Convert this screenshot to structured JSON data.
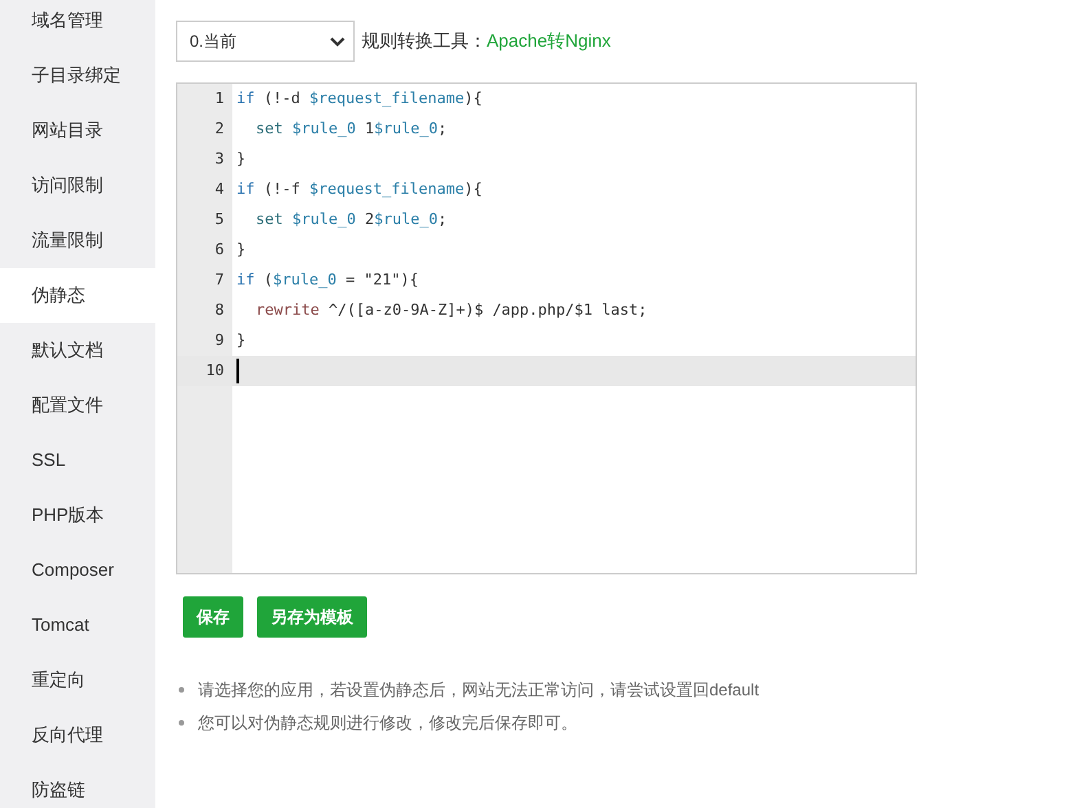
{
  "sidebar": {
    "items": [
      {
        "label": "域名管理",
        "selected": false
      },
      {
        "label": "子目录绑定",
        "selected": false
      },
      {
        "label": "网站目录",
        "selected": false
      },
      {
        "label": "访问限制",
        "selected": false
      },
      {
        "label": "流量限制",
        "selected": false
      },
      {
        "label": "伪静态",
        "selected": true
      },
      {
        "label": "默认文档",
        "selected": false
      },
      {
        "label": "配置文件",
        "selected": false
      },
      {
        "label": "SSL",
        "selected": false
      },
      {
        "label": "PHP版本",
        "selected": false
      },
      {
        "label": "Composer",
        "selected": false
      },
      {
        "label": "Tomcat",
        "selected": false
      },
      {
        "label": "重定向",
        "selected": false
      },
      {
        "label": "反向代理",
        "selected": false
      },
      {
        "label": "防盗链",
        "selected": false
      }
    ]
  },
  "template_select": {
    "value": "0.当前"
  },
  "converter": {
    "label": "规则转换工具：",
    "link": "Apache转Nginx"
  },
  "editor": {
    "lines": [
      {
        "number": "1",
        "indented": false,
        "active": false,
        "tokens": [
          {
            "kind": "keyword",
            "text": "if"
          },
          {
            "kind": "plain",
            "text": " (!-d "
          },
          {
            "kind": "variable",
            "text": "$request_filename"
          },
          {
            "kind": "plain",
            "text": "){"
          }
        ]
      },
      {
        "number": "2",
        "indented": true,
        "active": false,
        "tokens": [
          {
            "kind": "directive",
            "text": "set "
          },
          {
            "kind": "variable",
            "text": "$rule_0"
          },
          {
            "kind": "plain",
            "text": " 1"
          },
          {
            "kind": "variable",
            "text": "$rule_0"
          },
          {
            "kind": "plain",
            "text": ";"
          }
        ]
      },
      {
        "number": "3",
        "indented": false,
        "active": false,
        "tokens": [
          {
            "kind": "plain",
            "text": "}"
          }
        ]
      },
      {
        "number": "4",
        "indented": false,
        "active": false,
        "tokens": [
          {
            "kind": "keyword",
            "text": "if"
          },
          {
            "kind": "plain",
            "text": " (!-f "
          },
          {
            "kind": "variable",
            "text": "$request_filename"
          },
          {
            "kind": "plain",
            "text": "){"
          }
        ]
      },
      {
        "number": "5",
        "indented": true,
        "active": false,
        "tokens": [
          {
            "kind": "directive",
            "text": "set "
          },
          {
            "kind": "variable",
            "text": "$rule_0"
          },
          {
            "kind": "plain",
            "text": " 2"
          },
          {
            "kind": "variable",
            "text": "$rule_0"
          },
          {
            "kind": "plain",
            "text": ";"
          }
        ]
      },
      {
        "number": "6",
        "indented": false,
        "active": false,
        "tokens": [
          {
            "kind": "plain",
            "text": "}"
          }
        ]
      },
      {
        "number": "7",
        "indented": false,
        "active": false,
        "tokens": [
          {
            "kind": "keyword",
            "text": "if"
          },
          {
            "kind": "plain",
            "text": " ("
          },
          {
            "kind": "variable",
            "text": "$rule_0"
          },
          {
            "kind": "plain",
            "text": " = \"21\"){"
          }
        ]
      },
      {
        "number": "8",
        "indented": true,
        "active": false,
        "tokens": [
          {
            "kind": "rewrite",
            "text": "rewrite"
          },
          {
            "kind": "plain",
            "text": " ^/([a-z0-9A-Z]+)$ /app.php/$1 last;"
          }
        ]
      },
      {
        "number": "9",
        "indented": false,
        "active": false,
        "tokens": [
          {
            "kind": "plain",
            "text": "}"
          }
        ]
      },
      {
        "number": "10",
        "indented": false,
        "active": true
      }
    ]
  },
  "buttons": [
    {
      "label": "保存"
    },
    {
      "label": "另存为模板"
    }
  ],
  "notes": [
    "请选择您的应用，若设置伪静态后，网站无法正常访问，请尝试设置回default",
    "您可以对伪静态规则进行修改，修改完后保存即可。"
  ]
}
